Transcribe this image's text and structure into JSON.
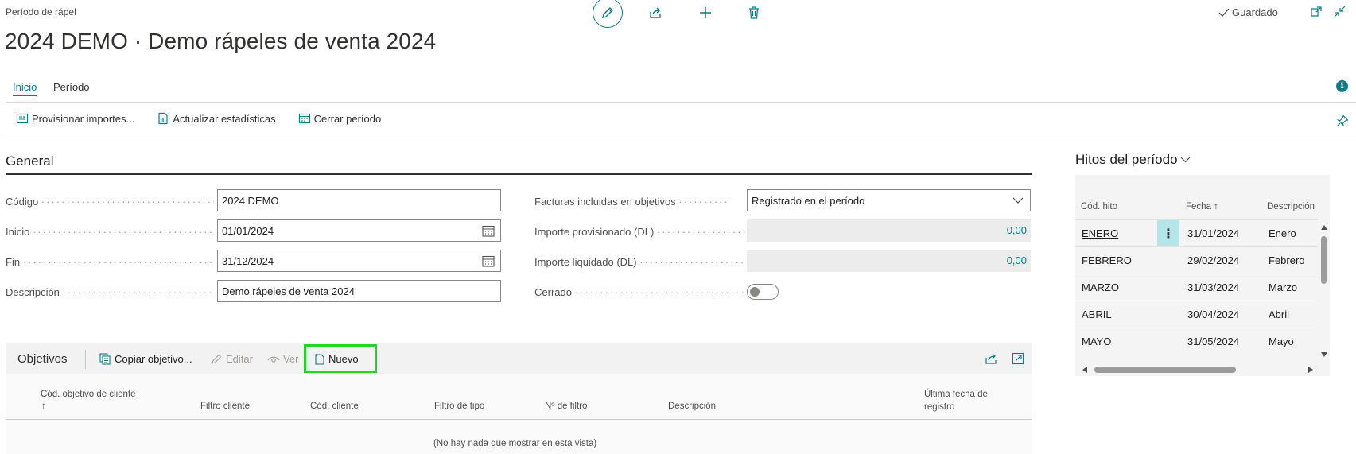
{
  "header": {
    "breadcrumb": "Período de rápel",
    "title": "2024 DEMO · Demo rápeles de venta 2024",
    "saved_label": "Guardado"
  },
  "tabs": [
    {
      "label": "Inicio",
      "active": true
    },
    {
      "label": "Período",
      "active": false
    }
  ],
  "actions": {
    "provision": "Provisionar importes...",
    "update_stats": "Actualizar estadísticas",
    "close_period": "Cerrar período"
  },
  "general": {
    "title": "General",
    "codigo_label": "Código",
    "codigo_value": "2024 DEMO",
    "inicio_label": "Inicio",
    "inicio_value": "01/01/2024",
    "fin_label": "Fin",
    "fin_value": "31/12/2024",
    "descripcion_label": "Descripción",
    "descripcion_value": "Demo rápeles de venta 2024",
    "facturas_label": "Facturas incluidas en objetivos",
    "facturas_value": "Registrado en el período",
    "provisionado_label": "Importe provisionado (DL)",
    "provisionado_value": "0,00",
    "liquidado_label": "Importe liquidado (DL)",
    "liquidado_value": "0,00",
    "cerrado_label": "Cerrado",
    "cerrado_value": false
  },
  "objetivos": {
    "title": "Objetivos",
    "copy_label": "Copiar objetivo...",
    "edit_label": "Editar",
    "view_label": "Ver",
    "new_label": "Nuevo",
    "columns": [
      "Cód. objetivo de cliente",
      "↑",
      "Filtro cliente",
      "Cód. cliente",
      "Filtro de tipo",
      "Nº de filtro",
      "Descripción",
      "Última fecha de",
      "registro"
    ],
    "empty_message": "(No hay nada que mostrar en esta vista)"
  },
  "hitos": {
    "title": "Hitos del período",
    "columns": [
      "Cód. hito",
      "Fecha",
      "Descripción"
    ],
    "rows": [
      {
        "code": "ENERO",
        "date": "31/01/2024",
        "desc": "Enero"
      },
      {
        "code": "FEBRERO",
        "date": "29/02/2024",
        "desc": "Febrero"
      },
      {
        "code": "MARZO",
        "date": "31/03/2024",
        "desc": "Marzo"
      },
      {
        "code": "ABRIL",
        "date": "30/04/2024",
        "desc": "Abril"
      },
      {
        "code": "MAYO",
        "date": "31/05/2024",
        "desc": "Mayo"
      }
    ]
  },
  "colors": {
    "accent": "#0e7c86",
    "highlight_green": "#22d428",
    "selection": "#b3e5e9"
  }
}
